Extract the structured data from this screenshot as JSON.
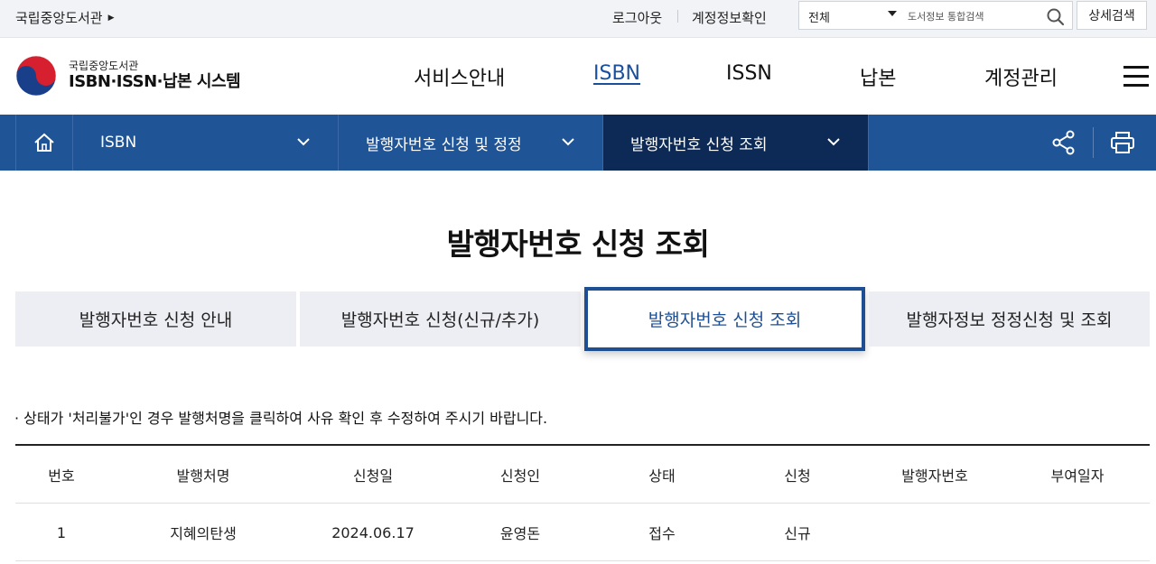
{
  "topbar": {
    "org_link": "국립중앙도서관",
    "logout": "로그아웃",
    "account_check": "계정정보확인",
    "search_scope": "전체",
    "search_placeholder": "도서정보 통합검색",
    "advanced_search": "상세검색"
  },
  "header": {
    "logo_small": "국립중앙도서관",
    "logo_big": "ISBN·ISSN·납본 시스템",
    "nav": [
      "서비스안내",
      "ISBN",
      "ISSN",
      "납본",
      "계정관리"
    ],
    "active_nav": "ISBN"
  },
  "location_bar": {
    "level1": "ISBN",
    "level2": "발행자번호 신청 및 정정",
    "level3": "발행자번호 신청 조회"
  },
  "page_title": "발행자번호 신청 조회",
  "tabs": [
    "발행자번호 신청 안내",
    "발행자번호 신청(신규/추가)",
    "발행자번호 신청 조회",
    "발행자정보 정정신청 및 조회"
  ],
  "active_tab": "발행자번호 신청 조회",
  "notice": "· 상태가 '처리불가'인 경우 발행처명을 클릭하여 사유 확인 후 수정하여 주시기 바랍니다.",
  "table": {
    "columns": [
      "번호",
      "발행처명",
      "신청일",
      "신청인",
      "상태",
      "신청",
      "발행자번호",
      "부여일자"
    ],
    "rows": [
      [
        "1",
        "지혜의탄생",
        "2024.06.17",
        "윤영돈",
        "접수",
        "신규",
        "",
        ""
      ]
    ]
  },
  "colors": {
    "primary_blue": "#1f5497",
    "dark_navy": "#0c2a55",
    "tab_bg": "#eceef3",
    "active_tab_border": "#1f4f93"
  }
}
